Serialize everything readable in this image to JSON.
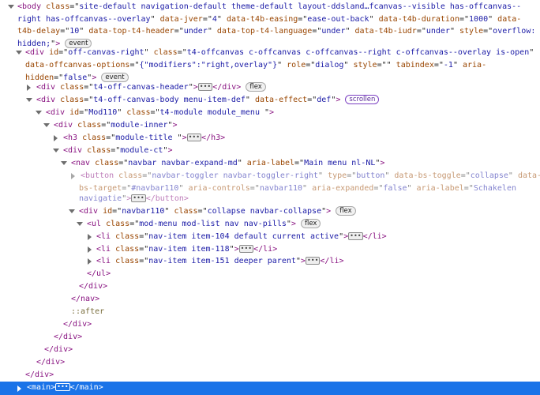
{
  "lines": [
    {
      "segs": [
        [
          "tag",
          "<body "
        ],
        [
          "an",
          "class"
        ],
        [
          "tx",
          "=\""
        ],
        [
          "av",
          "site-default navigation-default theme-default layout-ddsland…fcanvas--visible has-offcanvas--"
        ],
        [
          "tx",
          ""
        ]
      ]
    },
    {
      "segs": [
        [
          "av",
          "right has-offcanvas--overlay"
        ],
        [
          "tx",
          "\" "
        ],
        [
          "an",
          "data-jver"
        ],
        [
          "tx",
          "=\""
        ],
        [
          "av",
          "4"
        ],
        [
          "tx",
          "\" "
        ],
        [
          "an",
          "data-t4b-easing"
        ],
        [
          "tx",
          "=\""
        ],
        [
          "av",
          "ease-out-back"
        ],
        [
          "tx",
          "\" "
        ],
        [
          "an",
          "data-t4b-duration"
        ],
        [
          "tx",
          "=\""
        ],
        [
          "av",
          "1000"
        ],
        [
          "tx",
          "\" "
        ],
        [
          "an",
          "data-"
        ]
      ]
    },
    {
      "segs": [
        [
          "an",
          "t4b-delay"
        ],
        [
          "tx",
          "=\""
        ],
        [
          "av",
          "10"
        ],
        [
          "tx",
          "\" "
        ],
        [
          "an",
          "data-top-t4-header"
        ],
        [
          "tx",
          "=\""
        ],
        [
          "av",
          "under"
        ],
        [
          "tx",
          "\" "
        ],
        [
          "an",
          "data-top-t4-language"
        ],
        [
          "tx",
          "=\""
        ],
        [
          "av",
          "under"
        ],
        [
          "tx",
          "\" "
        ],
        [
          "an",
          "data-t4b-iudr"
        ],
        [
          "tx",
          "=\""
        ],
        [
          "av",
          "under"
        ],
        [
          "tx",
          "\" "
        ],
        [
          "an",
          "style"
        ],
        [
          "tx",
          "=\""
        ],
        [
          "av",
          "overflow:"
        ]
      ]
    },
    {
      "segs": [
        [
          "av",
          "hidden;"
        ],
        [
          "tx",
          "\""
        ],
        [
          "tag",
          ">"
        ]
      ],
      "badge": "event"
    },
    {
      "segs": [
        [
          "tag",
          "<div "
        ],
        [
          "an",
          "id"
        ],
        [
          "tx",
          "=\""
        ],
        [
          "av",
          "off-canvas-right"
        ],
        [
          "tx",
          "\" "
        ],
        [
          "an",
          "class"
        ],
        [
          "tx",
          "=\""
        ],
        [
          "av",
          "t4-offcanvas c-offcanvas c-offcanvas--right c-offcanvas--overlay is-open"
        ],
        [
          "tx",
          "\""
        ]
      ]
    },
    {
      "segs": [
        [
          "an",
          "data-offcanvas-options"
        ],
        [
          "tx",
          "=\""
        ],
        [
          "av",
          "{\"modifiers\":\"right,overlay\"}"
        ],
        [
          "tx",
          "\" "
        ],
        [
          "an",
          "role"
        ],
        [
          "tx",
          "=\""
        ],
        [
          "av",
          "dialog"
        ],
        [
          "tx",
          "\" "
        ],
        [
          "an",
          "style"
        ],
        [
          "tx",
          "=\"\" "
        ],
        [
          "an",
          "tabindex"
        ],
        [
          "tx",
          "=\""
        ],
        [
          "av",
          "-1"
        ],
        [
          "tx",
          "\" "
        ],
        [
          "an",
          "aria-"
        ]
      ]
    },
    {
      "segs": [
        [
          "an",
          "hidden"
        ],
        [
          "tx",
          "=\""
        ],
        [
          "av",
          "false"
        ],
        [
          "tx",
          "\""
        ],
        [
          "tag",
          ">"
        ]
      ],
      "badge": "event"
    },
    {
      "segs": [
        [
          "tag",
          "<div "
        ],
        [
          "an",
          "class"
        ],
        [
          "tx",
          "=\""
        ],
        [
          "av",
          "t4-off-canvas-header"
        ],
        [
          "tx",
          "\""
        ],
        [
          "tag",
          ">"
        ]
      ],
      "ellipsis": true,
      "after": [
        [
          "tag",
          "</div>"
        ]
      ],
      "badge": "flex"
    },
    {
      "segs": [
        [
          "tag",
          "<div "
        ],
        [
          "an",
          "class"
        ],
        [
          "tx",
          "=\""
        ],
        [
          "av",
          "t4-off-canvas-body menu-item-def"
        ],
        [
          "tx",
          "\" "
        ],
        [
          "an",
          "data-effect"
        ],
        [
          "tx",
          "=\""
        ],
        [
          "av",
          "def"
        ],
        [
          "tx",
          "\""
        ],
        [
          "tag",
          ">"
        ]
      ],
      "badge": "scrollen",
      "badgeStyle": "purple"
    },
    {
      "segs": [
        [
          "tag",
          "<div "
        ],
        [
          "an",
          "id"
        ],
        [
          "tx",
          "=\""
        ],
        [
          "av",
          "Mod110"
        ],
        [
          "tx",
          "\" "
        ],
        [
          "an",
          "class"
        ],
        [
          "tx",
          "=\""
        ],
        [
          "av",
          "t4-module module_menu "
        ],
        [
          "tx",
          "\""
        ],
        [
          "tag",
          ">"
        ]
      ]
    },
    {
      "segs": [
        [
          "tag",
          "<div "
        ],
        [
          "an",
          "class"
        ],
        [
          "tx",
          "=\""
        ],
        [
          "av",
          "module-inner"
        ],
        [
          "tx",
          "\""
        ],
        [
          "tag",
          ">"
        ]
      ]
    },
    {
      "segs": [
        [
          "tag",
          "<h3 "
        ],
        [
          "an",
          "class"
        ],
        [
          "tx",
          "=\""
        ],
        [
          "av",
          "module-title "
        ],
        [
          "tx",
          "\""
        ],
        [
          "tag",
          ">"
        ]
      ],
      "ellipsis": true,
      "after": [
        [
          "tag",
          "</h3>"
        ]
      ]
    },
    {
      "segs": [
        [
          "tag",
          "<div "
        ],
        [
          "an",
          "class"
        ],
        [
          "tx",
          "=\""
        ],
        [
          "av",
          "module-ct"
        ],
        [
          "tx",
          "\""
        ],
        [
          "tag",
          ">"
        ]
      ]
    },
    {
      "segs": [
        [
          "tag",
          "<nav "
        ],
        [
          "an",
          "class"
        ],
        [
          "tx",
          "=\""
        ],
        [
          "av",
          "navbar navbar-expand-md"
        ],
        [
          "tx",
          "\" "
        ],
        [
          "an",
          "aria-label"
        ],
        [
          "tx",
          "=\""
        ],
        [
          "av",
          "Main menu nl-NL"
        ],
        [
          "tx",
          "\""
        ],
        [
          "tag",
          ">"
        ]
      ]
    },
    {
      "segs": [
        [
          "tag",
          "<button "
        ],
        [
          "an",
          "class"
        ],
        [
          "tx",
          "=\""
        ],
        [
          "av",
          "navbar-toggler navbar-toggler-right"
        ],
        [
          "tx",
          "\" "
        ],
        [
          "an",
          "type"
        ],
        [
          "tx",
          "=\""
        ],
        [
          "av",
          "button"
        ],
        [
          "tx",
          "\" "
        ],
        [
          "an",
          "data-bs-toggle"
        ],
        [
          "tx",
          "=\""
        ],
        [
          "av",
          "collapse"
        ],
        [
          "tx",
          "\" "
        ],
        [
          "an",
          "data-"
        ]
      ]
    },
    {
      "segs": [
        [
          "an",
          "bs-target"
        ],
        [
          "tx",
          "=\""
        ],
        [
          "av",
          "#navbar110"
        ],
        [
          "tx",
          "\" "
        ],
        [
          "an",
          "aria-controls"
        ],
        [
          "tx",
          "=\""
        ],
        [
          "av",
          "navbar110"
        ],
        [
          "tx",
          "\" "
        ],
        [
          "an",
          "aria-expanded"
        ],
        [
          "tx",
          "=\""
        ],
        [
          "av",
          "false"
        ],
        [
          "tx",
          "\" "
        ],
        [
          "an",
          "aria-label"
        ],
        [
          "tx",
          "=\""
        ],
        [
          "av",
          "Schakelen"
        ]
      ]
    },
    {
      "segs": [
        [
          "av",
          "navigatie"
        ],
        [
          "tx",
          "\""
        ],
        [
          "tag",
          ">"
        ]
      ],
      "ellipsis": true,
      "after": [
        [
          "tag",
          "</button>"
        ]
      ]
    },
    {
      "segs": [
        [
          "tag",
          "<div "
        ],
        [
          "an",
          "id"
        ],
        [
          "tx",
          "=\""
        ],
        [
          "av",
          "navbar110"
        ],
        [
          "tx",
          "\" "
        ],
        [
          "an",
          "class"
        ],
        [
          "tx",
          "=\""
        ],
        [
          "av",
          "collapse navbar-collapse"
        ],
        [
          "tx",
          "\""
        ],
        [
          "tag",
          ">"
        ]
      ],
      "badge": "flex"
    },
    {
      "segs": [
        [
          "tag",
          "<ul "
        ],
        [
          "an",
          "class"
        ],
        [
          "tx",
          "=\""
        ],
        [
          "av",
          "mod-menu mod-list nav nav-pills"
        ],
        [
          "tx",
          "\""
        ],
        [
          "tag",
          ">"
        ]
      ],
      "badge": "flex"
    },
    {
      "segs": [
        [
          "tag",
          "<li "
        ],
        [
          "an",
          "class"
        ],
        [
          "tx",
          "=\""
        ],
        [
          "av",
          "nav-item item-104 default current active"
        ],
        [
          "tx",
          "\""
        ],
        [
          "tag",
          ">"
        ]
      ],
      "ellipsis": true,
      "after": [
        [
          "tag",
          "</li>"
        ]
      ]
    },
    {
      "segs": [
        [
          "tag",
          "<li "
        ],
        [
          "an",
          "class"
        ],
        [
          "tx",
          "=\""
        ],
        [
          "av",
          "nav-item item-118"
        ],
        [
          "tx",
          "\""
        ],
        [
          "tag",
          ">"
        ]
      ],
      "ellipsis": true,
      "after": [
        [
          "tag",
          "</li>"
        ]
      ]
    },
    {
      "segs": [
        [
          "tag",
          "<li "
        ],
        [
          "an",
          "class"
        ],
        [
          "tx",
          "=\""
        ],
        [
          "av",
          "nav-item item-151 deeper parent"
        ],
        [
          "tx",
          "\""
        ],
        [
          "tag",
          ">"
        ]
      ],
      "ellipsis": true,
      "after": [
        [
          "tag",
          "</li>"
        ]
      ]
    },
    {
      "segs": [
        [
          "tag",
          "</ul>"
        ]
      ]
    },
    {
      "segs": [
        [
          "tag",
          "</div>"
        ]
      ]
    },
    {
      "segs": [
        [
          "tag",
          "</nav>"
        ]
      ]
    },
    {
      "segs": [
        [
          "pseudo",
          "::after"
        ]
      ]
    },
    {
      "segs": [
        [
          "tag",
          "</div>"
        ]
      ]
    },
    {
      "segs": [
        [
          "tag",
          "</div>"
        ]
      ]
    },
    {
      "segs": [
        [
          "tag",
          "</div>"
        ]
      ]
    },
    {
      "segs": [
        [
          "tag",
          "</div>"
        ]
      ]
    },
    {
      "segs": [
        [
          "tag",
          "</div>"
        ]
      ]
    },
    {
      "segs": [
        [
          "tag",
          "<main>"
        ]
      ],
      "ellipsis": true,
      "after": [
        [
          "tag",
          "</main>"
        ]
      ]
    }
  ]
}
